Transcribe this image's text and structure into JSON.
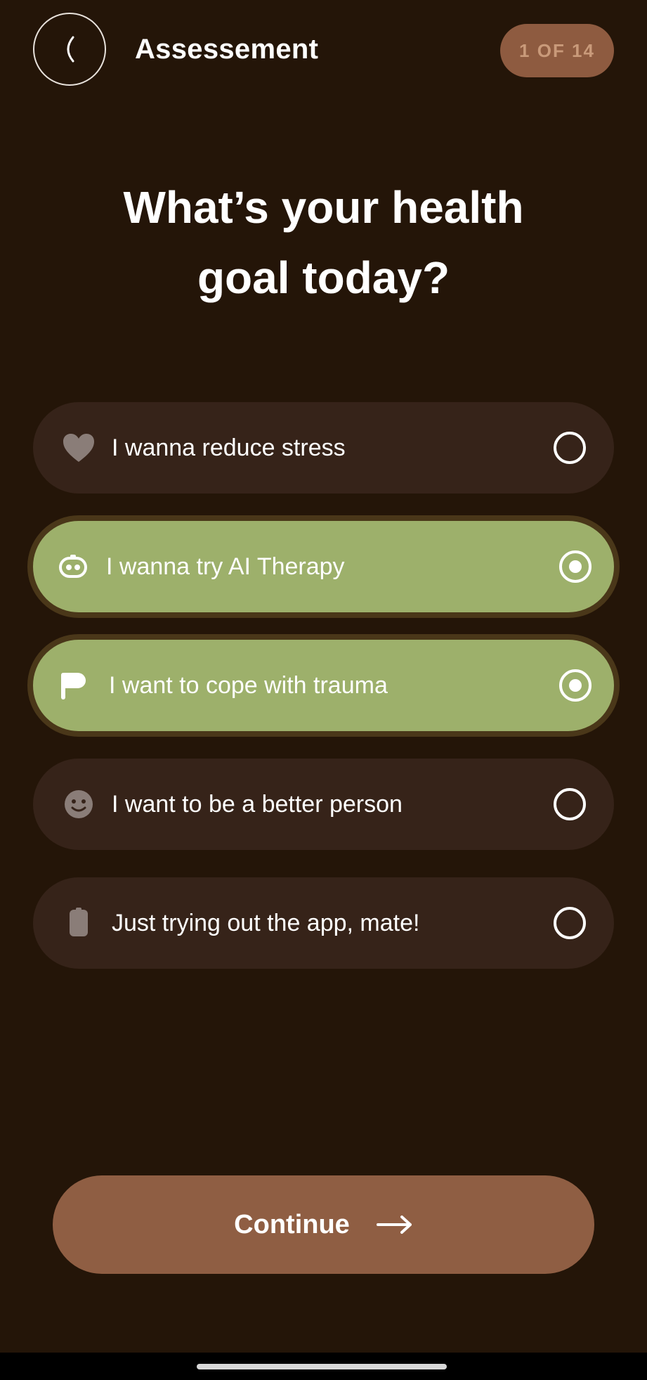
{
  "header": {
    "back_icon": "chevron-left-icon",
    "title": "Assessement",
    "progress": "1 OF 14"
  },
  "question": "What’s your health\ngoal today?",
  "options": [
    {
      "label": "I wanna reduce stress",
      "icon": "heart-icon",
      "selected": false
    },
    {
      "label": "I wanna try AI Therapy",
      "icon": "robot-icon",
      "selected": true
    },
    {
      "label": "I want to cope with trauma",
      "icon": "flag-icon",
      "selected": true
    },
    {
      "label": "I want to be a better person",
      "icon": "smiley-icon",
      "selected": false
    },
    {
      "label": "Just trying out the app, mate!",
      "icon": "phone-icon",
      "selected": false
    }
  ],
  "continue_button": {
    "label": "Continue",
    "icon": "arrow-right-icon"
  },
  "colors": {
    "background": "#241508",
    "option_bg": "#362319",
    "selected_bg": "#9db06b",
    "accent_brown": "#8f5e43"
  }
}
